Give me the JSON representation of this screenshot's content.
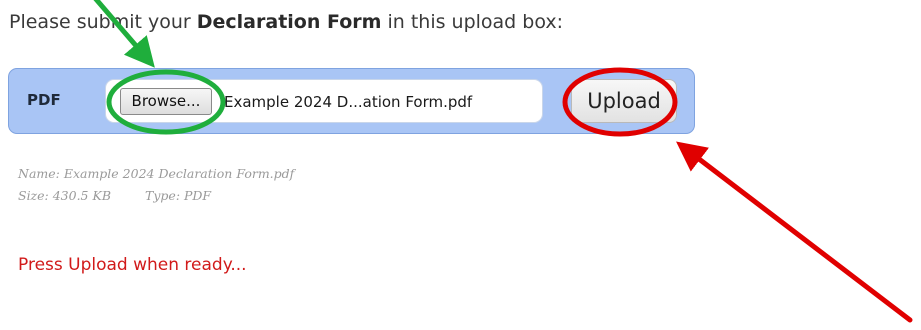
{
  "instruction": {
    "prefix": "Please submit your ",
    "bold": "Declaration Form",
    "suffix": " in this upload box:"
  },
  "upload_box": {
    "type_label": "PDF",
    "browse_label": "Browse...",
    "selected_file": "Example 2024 D...ation Form.pdf",
    "upload_label": "Upload"
  },
  "file_info": {
    "name": "Name: Example 2024 Declaration Form.pdf",
    "size": "Size: 430.5 KB",
    "type": "Type: PDF"
  },
  "status_message": "Press Upload when ready...",
  "colors": {
    "box_background": "#a9c5f5",
    "status_text": "#d11a1a",
    "annotation_green": "#1fae3c",
    "annotation_red": "#e00000"
  },
  "annotations": [
    {
      "shape": "ellipse",
      "color": "green",
      "target": "browse-button"
    },
    {
      "shape": "ellipse",
      "color": "red",
      "target": "upload-button"
    },
    {
      "shape": "arrow",
      "color": "green",
      "target": "browse-button"
    },
    {
      "shape": "arrow",
      "color": "red",
      "target": "upload-button"
    }
  ]
}
